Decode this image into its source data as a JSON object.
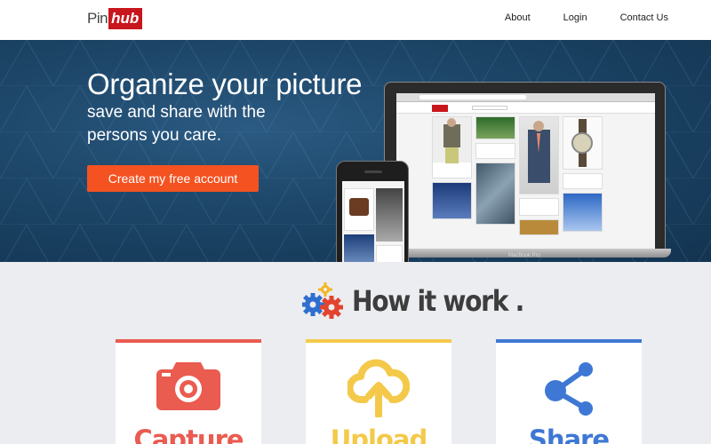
{
  "header": {
    "logo_pin": "Pin",
    "logo_hub": "hub",
    "nav": [
      {
        "label": "About"
      },
      {
        "label": "Login"
      },
      {
        "label": "Contact Us"
      }
    ]
  },
  "hero": {
    "title": "Organize your picture",
    "subtitle": "save and share with the persons you care.",
    "cta_label": "Create my free account",
    "laptop_label": "MacBook Pro"
  },
  "how": {
    "title": "How it work ."
  },
  "cards": [
    {
      "label": "Capture",
      "icon": "camera-icon",
      "color": "#ea5b50"
    },
    {
      "label": "Upload",
      "icon": "cloud-upload-icon",
      "color": "#f4c94a"
    },
    {
      "label": "Share",
      "icon": "share-icon",
      "color": "#3e78d4"
    }
  ],
  "colors": {
    "brand": "#c8161d",
    "cta": "#f45221",
    "hero_bg": "#1c4567"
  }
}
